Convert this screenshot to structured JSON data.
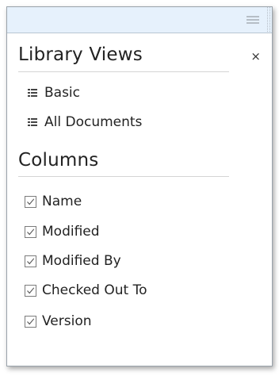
{
  "panel": {
    "library_views_title": "Library Views",
    "close_label": "×",
    "views": [
      {
        "label": "Basic"
      },
      {
        "label": "All Documents"
      }
    ],
    "columns_title": "Columns",
    "columns": [
      {
        "label": "Name",
        "checked": true
      },
      {
        "label": "Modified",
        "checked": true
      },
      {
        "label": "Modified By",
        "checked": true
      },
      {
        "label": "Checked Out To",
        "checked": true
      },
      {
        "label": "Version",
        "checked": true
      }
    ]
  },
  "colors": {
    "topbar": "#e6f1fc",
    "text": "#222222",
    "checkbox_border": "#7b7b7b"
  },
  "icons": {
    "view_icon": "list-view-icon",
    "checkbox_icon": "checkmark-icon",
    "grip_icon": "grip-handle-icon"
  }
}
